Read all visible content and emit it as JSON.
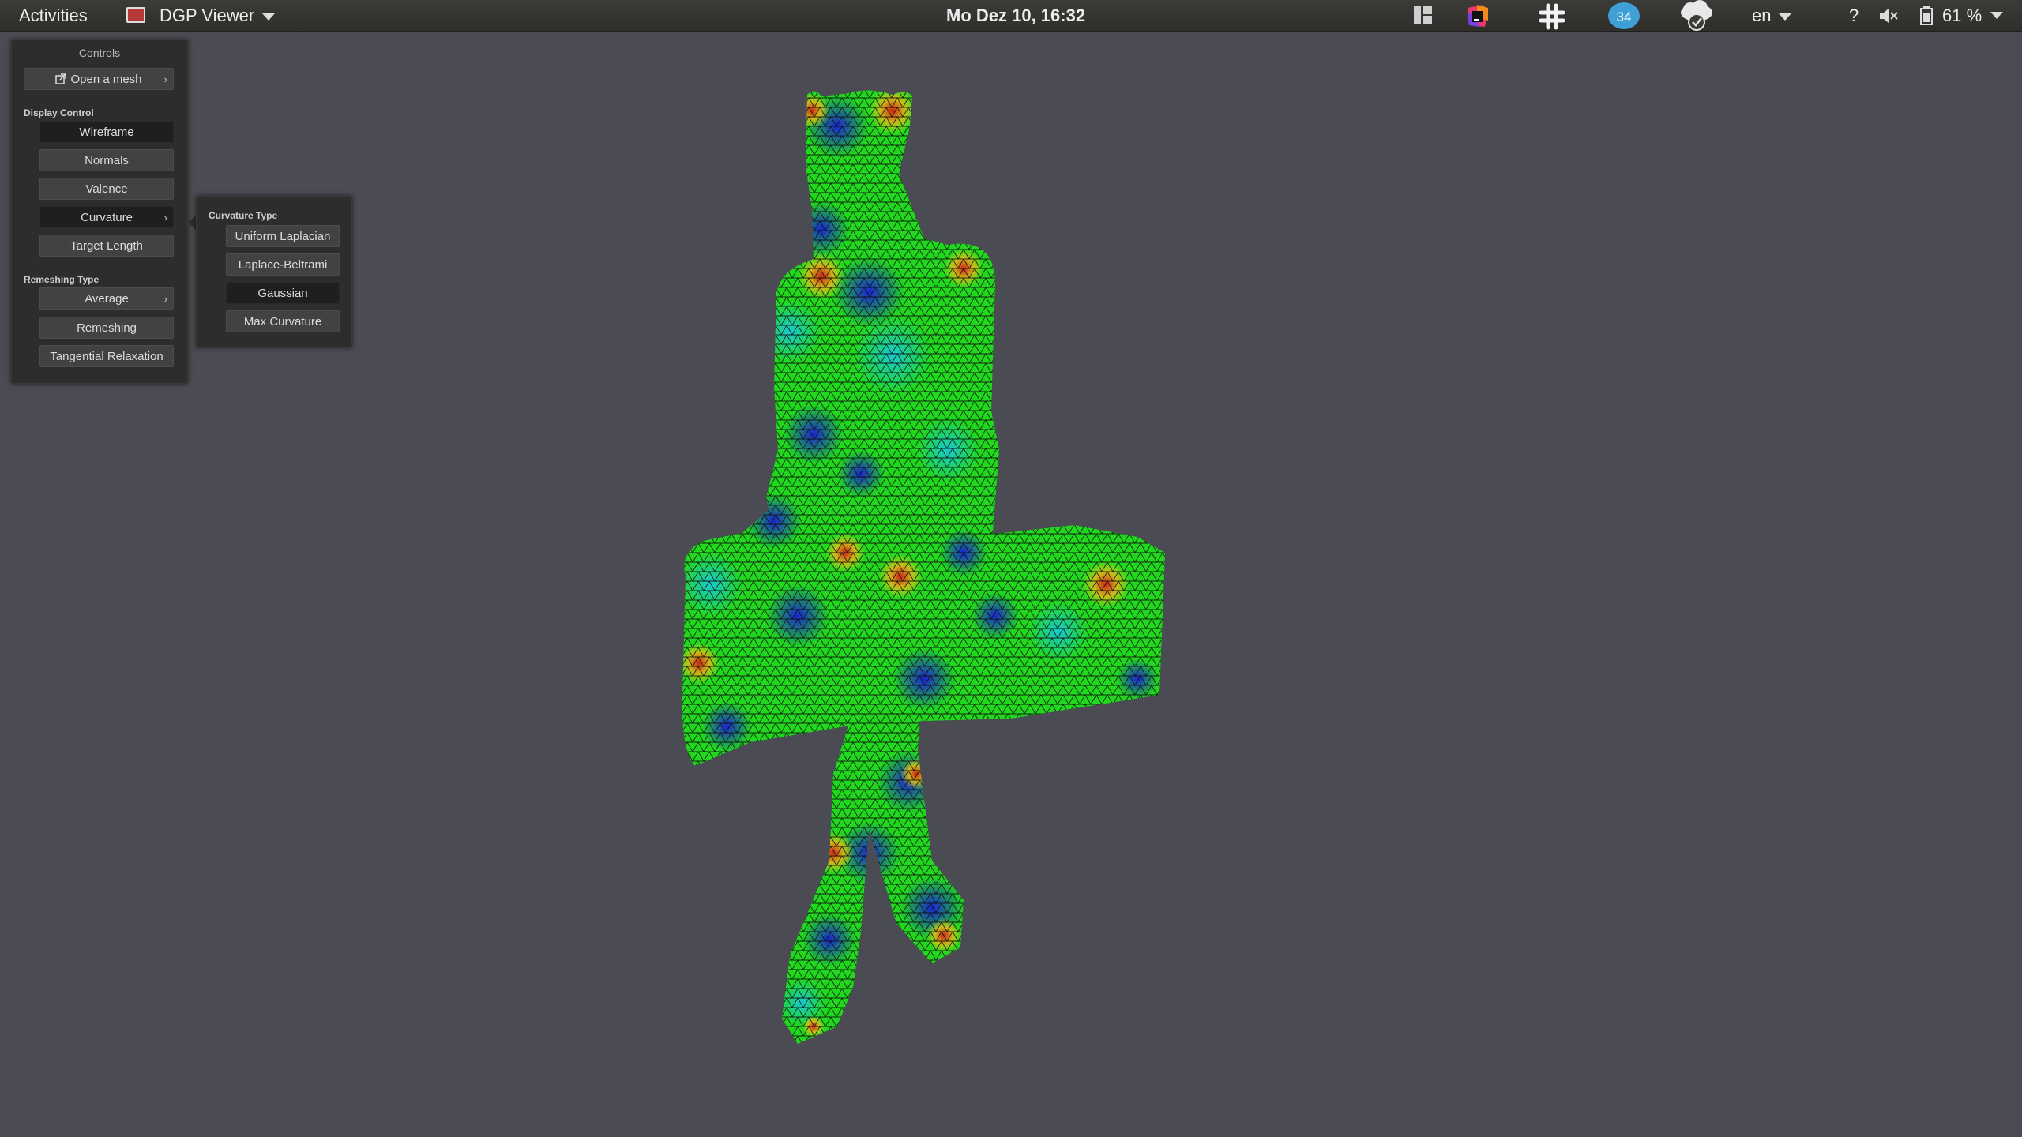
{
  "topbar": {
    "activities": "Activities",
    "app_name": "DGP Viewer",
    "clock": "Mo Dez 10, 16:32",
    "badge_count": "34",
    "language": "en",
    "help": "?",
    "battery": "61 %",
    "icons": [
      "layout-icon",
      "jetbrains-toolbox-icon",
      "slack-icon",
      "notification-badge",
      "cloud-sync-icon",
      "sound-muted-icon",
      "battery-icon"
    ]
  },
  "controls": {
    "title": "Controls",
    "open_mesh": "Open a mesh",
    "display_control_label": "Display Control",
    "wireframe": "Wireframe",
    "normals": "Normals",
    "valence": "Valence",
    "curvature": "Curvature",
    "target_length": "Target Length",
    "remeshing_type_label": "Remeshing Type",
    "average": "Average",
    "remeshing": "Remeshing",
    "tangential_relaxation": "Tangential Relaxation",
    "chevron": "›"
  },
  "curvature_popup": {
    "title": "Curvature Type",
    "options": [
      "Uniform Laplacian",
      "Laplace-Beltrami",
      "Gaussian",
      "Max Curvature"
    ],
    "selected": "Gaussian"
  },
  "viewport": {
    "content": "mesh-render",
    "colors": {
      "low": "#1a1adc",
      "mid_low": "#18c8d8",
      "mid": "#22d81e",
      "mid_high": "#d8d818",
      "high": "#d81818",
      "background": "#4b4b53",
      "wire": "#0a0a0a"
    }
  }
}
